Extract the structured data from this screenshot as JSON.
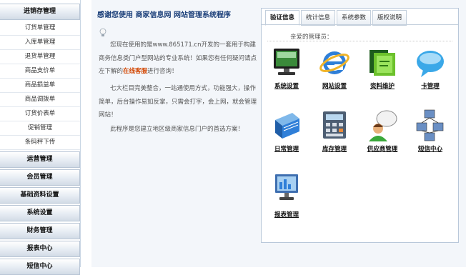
{
  "sidebar": {
    "first_section": {
      "title": "进销存管理",
      "items": [
        "订货单管理",
        "入库单管理",
        "退货单管理",
        "商品支价单",
        "商品损益单",
        "商品调拨单",
        "订货价表单",
        "促销管理",
        "条码秤下传"
      ]
    },
    "sections": [
      "运营管理",
      "会员管理",
      "基础资料设置",
      "系统设置",
      "财务管理",
      "报表中心",
      "短信中心"
    ]
  },
  "intro": {
    "title": "感谢您使用 商家信息网 网站管理系统程序",
    "p1_before": "您现在使用的是www.865171.cn开发的一套用于构建商务信息类门户型网站的专业系统！如果您有任何疑问请点左下解的",
    "p1_highlight": "在线客服",
    "p1_after": "进行咨询！",
    "p2": "七大栏目完美整合，一站通使用方式，功能强大，操作简单，后台操作易如反掌，只需会打字，会上网，就会管理网站！",
    "p3": "此程序是您建立地区级商家信息门户的首选方案！"
  },
  "tabs": [
    {
      "label": "验证信息",
      "active": true
    },
    {
      "label": "统计信息",
      "active": false
    },
    {
      "label": "系统参数",
      "active": false
    },
    {
      "label": "版权说明",
      "active": false
    }
  ],
  "greeting": "亲爱的管理员：",
  "apps": [
    {
      "label": "系统设置",
      "icon": "monitor-icon"
    },
    {
      "label": "网站设置",
      "icon": "ie-browser-icon"
    },
    {
      "label": "资料维护",
      "icon": "green-folder-icon"
    },
    {
      "label": "卡管理",
      "icon": "chat-bubble-icon"
    },
    {
      "label": "日常管理",
      "icon": "blue-book-icon"
    },
    {
      "label": "库存管理",
      "icon": "calculator-icon"
    },
    {
      "label": "供应商管理",
      "icon": "user-bubble-icon"
    },
    {
      "label": "短信中心",
      "icon": "network-computers-icon"
    },
    {
      "label": "报表管理",
      "icon": "report-monitor-icon"
    }
  ]
}
